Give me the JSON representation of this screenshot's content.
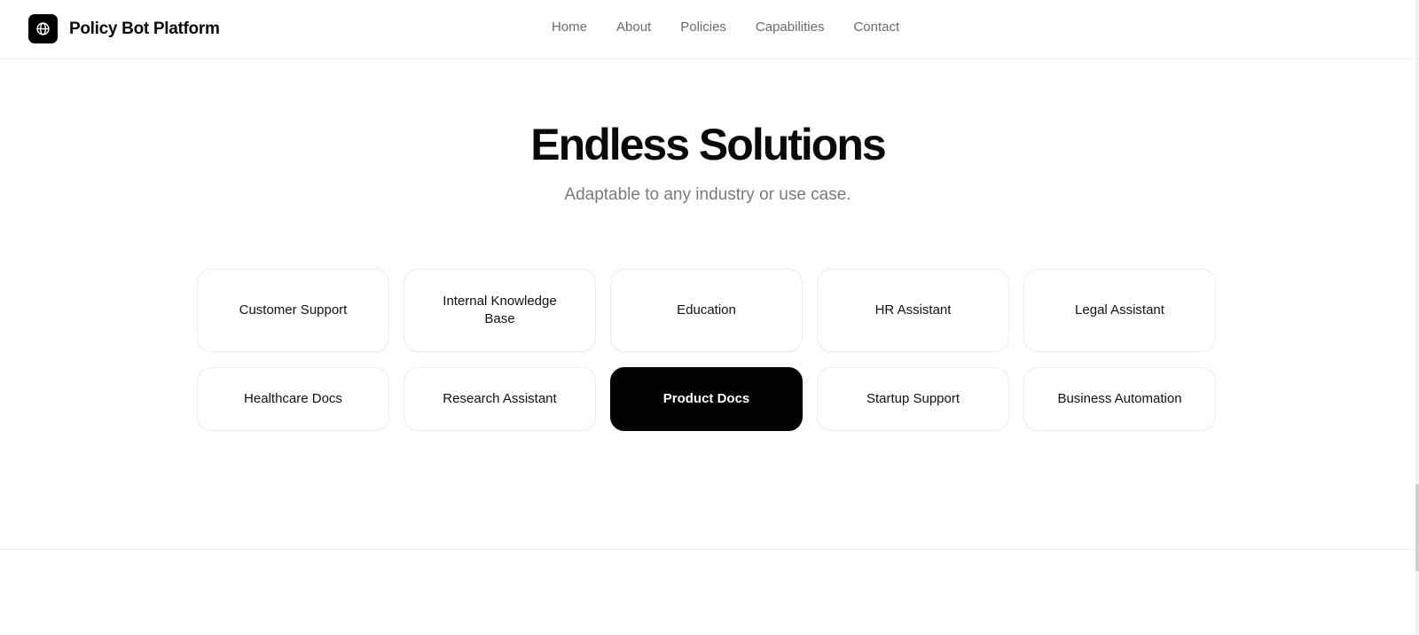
{
  "brand": {
    "name": "Policy Bot Platform",
    "icon": "globe-icon"
  },
  "nav": {
    "items": [
      {
        "label": "Home"
      },
      {
        "label": "About"
      },
      {
        "label": "Policies"
      },
      {
        "label": "Capabilities"
      },
      {
        "label": "Contact"
      }
    ]
  },
  "hero": {
    "title": "Endless Solutions",
    "subtitle": "Adaptable to any industry or use case."
  },
  "solutions": {
    "items": [
      {
        "label": "Customer Support"
      },
      {
        "label": "Internal Knowledge Base"
      },
      {
        "label": "Education"
      },
      {
        "label": "HR Assistant"
      },
      {
        "label": "Legal Assistant"
      },
      {
        "label": "Healthcare Docs"
      },
      {
        "label": "Research Assistant"
      },
      {
        "label": "Product Docs",
        "active": true
      },
      {
        "label": "Startup Support"
      },
      {
        "label": "Business Automation"
      }
    ]
  },
  "colors": {
    "accent": "#000000",
    "muted_text": "#7a7a7a",
    "border": "#ececec"
  }
}
